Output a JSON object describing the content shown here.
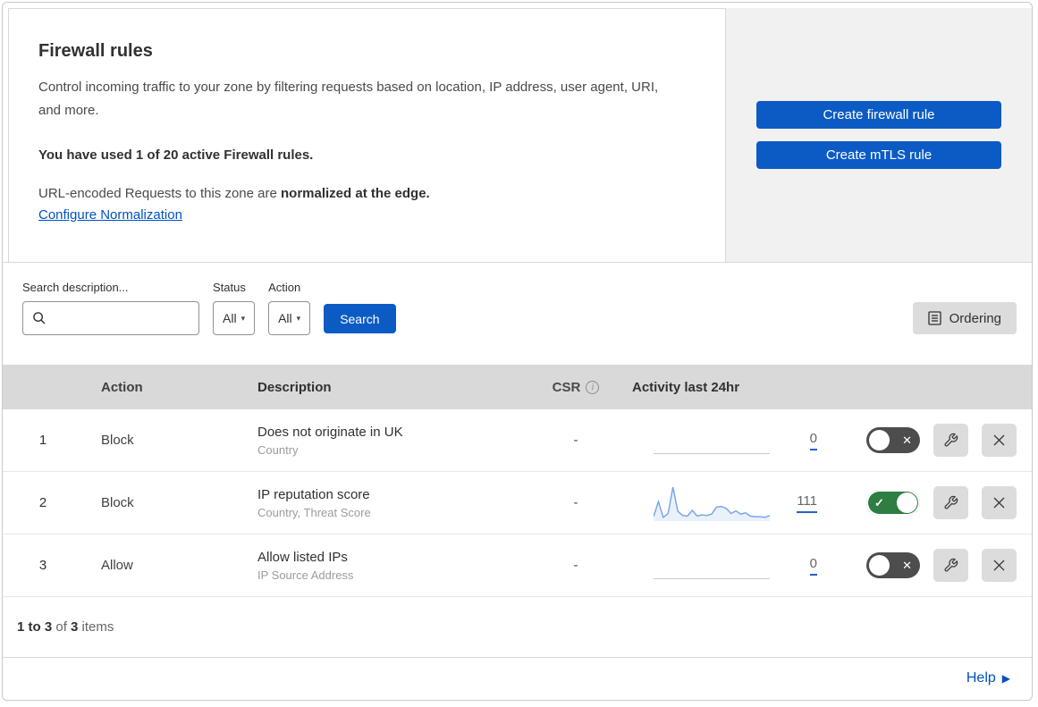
{
  "header": {
    "title": "Firewall rules",
    "description": "Control incoming traffic to your zone by filtering requests based on location, IP address, user agent, URI, and more.",
    "usage": "You have used 1 of 20 active Firewall rules.",
    "normalization_prefix": "URL-encoded Requests to this zone are ",
    "normalization_bold": "normalized at the edge.",
    "normalization_link": "Configure Normalization"
  },
  "cta": {
    "create_firewall_label": "Create firewall rule",
    "create_mtls_label": "Create mTLS rule"
  },
  "filters": {
    "search_label": "Search description...",
    "search_value": "",
    "status_label": "Status",
    "status_value": "All",
    "action_label": "Action",
    "action_value": "All",
    "search_button": "Search",
    "ordering_button": "Ordering"
  },
  "table": {
    "columns": {
      "action": "Action",
      "description": "Description",
      "csr": "CSR",
      "activity": "Activity last 24hr"
    },
    "rows": [
      {
        "index": "1",
        "action": "Block",
        "description": "Does not originate in UK",
        "fields": "Country",
        "csr": "-",
        "activity_count": "0",
        "enabled": false
      },
      {
        "index": "2",
        "action": "Block",
        "description": "IP reputation score",
        "fields": "Country, Threat Score",
        "csr": "-",
        "activity_count": "111",
        "enabled": true
      },
      {
        "index": "3",
        "action": "Allow",
        "description": "Allow listed IPs",
        "fields": "IP Source Address",
        "csr": "-",
        "activity_count": "0",
        "enabled": false
      }
    ],
    "sparkline_values": [
      8,
      55,
      6,
      18,
      100,
      25,
      12,
      10,
      28,
      10,
      14,
      12,
      16,
      38,
      40,
      34,
      18,
      26,
      16,
      20,
      10,
      8,
      8,
      6,
      12
    ]
  },
  "footer": {
    "range": "1 to 3",
    "of_text": " of ",
    "total": "3",
    "items_text": " items",
    "help_label": "Help"
  },
  "colors": {
    "primary_button": "#0c5bc5",
    "link": "#0051c3",
    "toggle_on": "#2e7d43",
    "toggle_off": "#4d4d4d",
    "sparkline": "#7aa7e9",
    "table_header_bg": "#d9d9d9"
  }
}
